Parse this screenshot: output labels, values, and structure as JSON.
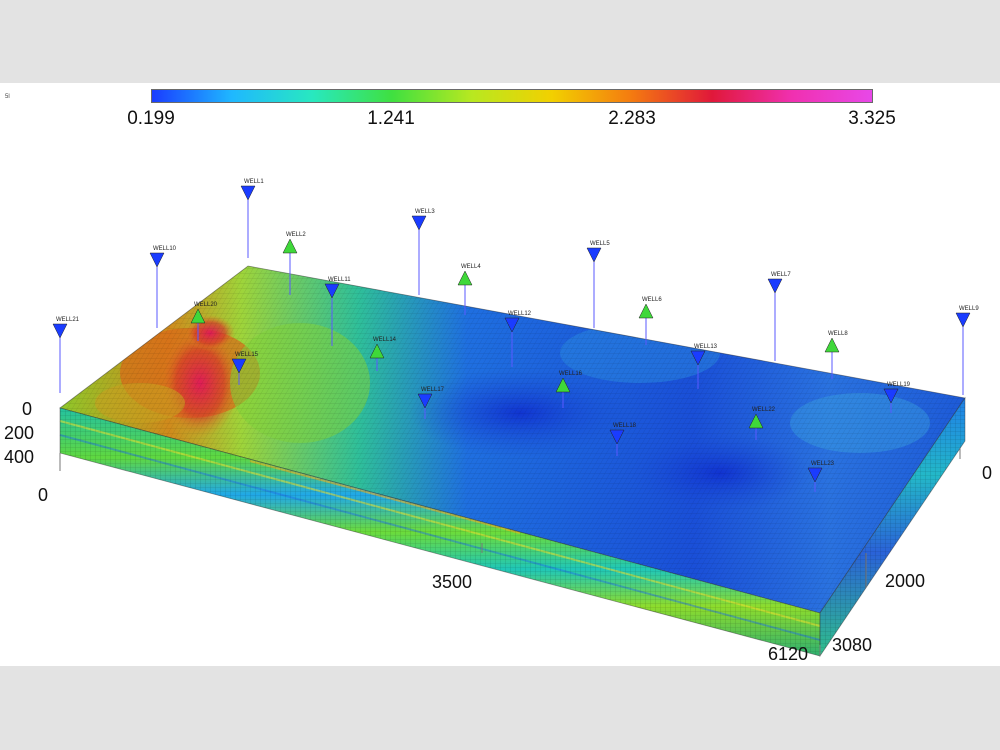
{
  "figure_tag": "5l",
  "colorbar": {
    "colors": [
      "#1a3cff",
      "#1fb8ff",
      "#28e8c0",
      "#3fe040",
      "#b8e820",
      "#f2d000",
      "#f47a10",
      "#e0183a",
      "#f030b0",
      "#e848e8"
    ],
    "labels": [
      "0.199",
      "1.241",
      "2.283",
      "3.325"
    ]
  },
  "axes": {
    "depth_ticks": [
      "0",
      "200",
      "400"
    ],
    "x_ticks": [
      "0",
      "3500",
      "6120"
    ],
    "y_ticks": [
      "0",
      "2000",
      "3080"
    ]
  },
  "wells": [
    {
      "name": "WELL1",
      "color": "#1a3cff",
      "symbol": "down"
    },
    {
      "name": "WELL2",
      "color": "#3fd83a",
      "symbol": "up"
    },
    {
      "name": "WELL3",
      "color": "#1a3cff",
      "symbol": "down"
    },
    {
      "name": "WELL4",
      "color": "#3fd83a",
      "symbol": "up"
    },
    {
      "name": "WELL5",
      "color": "#1a3cff",
      "symbol": "down"
    },
    {
      "name": "WELL6",
      "color": "#3fd83a",
      "symbol": "up"
    },
    {
      "name": "WELL7",
      "color": "#1a3cff",
      "symbol": "down"
    },
    {
      "name": "WELL8",
      "color": "#3fd83a",
      "symbol": "up"
    },
    {
      "name": "WELL9",
      "color": "#1a3cff",
      "symbol": "down"
    },
    {
      "name": "WELL10",
      "color": "#1a3cff",
      "symbol": "down"
    },
    {
      "name": "WELL11",
      "color": "#1a3cff",
      "symbol": "down"
    },
    {
      "name": "WELL12",
      "color": "#1a3cff",
      "symbol": "down"
    },
    {
      "name": "WELL13",
      "color": "#1a3cff",
      "symbol": "down"
    },
    {
      "name": "WELL14",
      "color": "#3fd83a",
      "symbol": "up"
    },
    {
      "name": "WELL15",
      "color": "#1a3cff",
      "symbol": "down"
    },
    {
      "name": "WELL16",
      "color": "#3fd83a",
      "symbol": "up"
    },
    {
      "name": "WELL17",
      "color": "#1a3cff",
      "symbol": "down"
    },
    {
      "name": "WELL18",
      "color": "#1a3cff",
      "symbol": "down"
    },
    {
      "name": "WELL19",
      "color": "#1a3cff",
      "symbol": "down"
    },
    {
      "name": "WELL20",
      "color": "#3fd83a",
      "symbol": "up"
    },
    {
      "name": "WELL21",
      "color": "#1a3cff",
      "symbol": "down"
    },
    {
      "name": "WELL22",
      "color": "#3fd83a",
      "symbol": "up"
    },
    {
      "name": "WELL23",
      "color": "#1a3cff",
      "symbol": "down"
    }
  ]
}
